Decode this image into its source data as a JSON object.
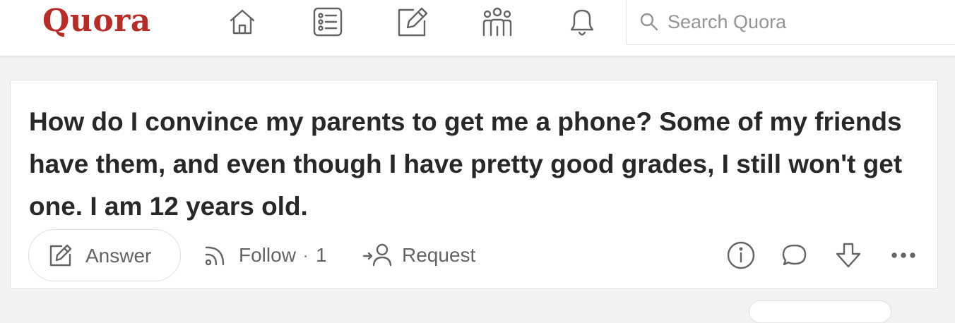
{
  "header": {
    "logo_text": "Quora",
    "nav_icons": [
      "home-icon",
      "following-icon",
      "answer-icon",
      "spaces-icon",
      "notifications-icon"
    ],
    "search_placeholder": "Search Quora"
  },
  "question": {
    "text": "How do I convince my parents to get me a phone? Some of my friends have them, and even though I have pretty good grades, I still won't get one. I am 12 years old.",
    "actions": {
      "answer_label": "Answer",
      "follow_label": "Follow",
      "follow_separator": "·",
      "follow_count": "1",
      "request_label": "Request"
    },
    "right_icons": [
      "info-icon",
      "comment-icon",
      "downvote-icon",
      "more-icon"
    ]
  },
  "colors": {
    "brand": "#b92b27",
    "background": "#f1f2f2",
    "icon_gray": "#636466",
    "text": "#282829"
  }
}
